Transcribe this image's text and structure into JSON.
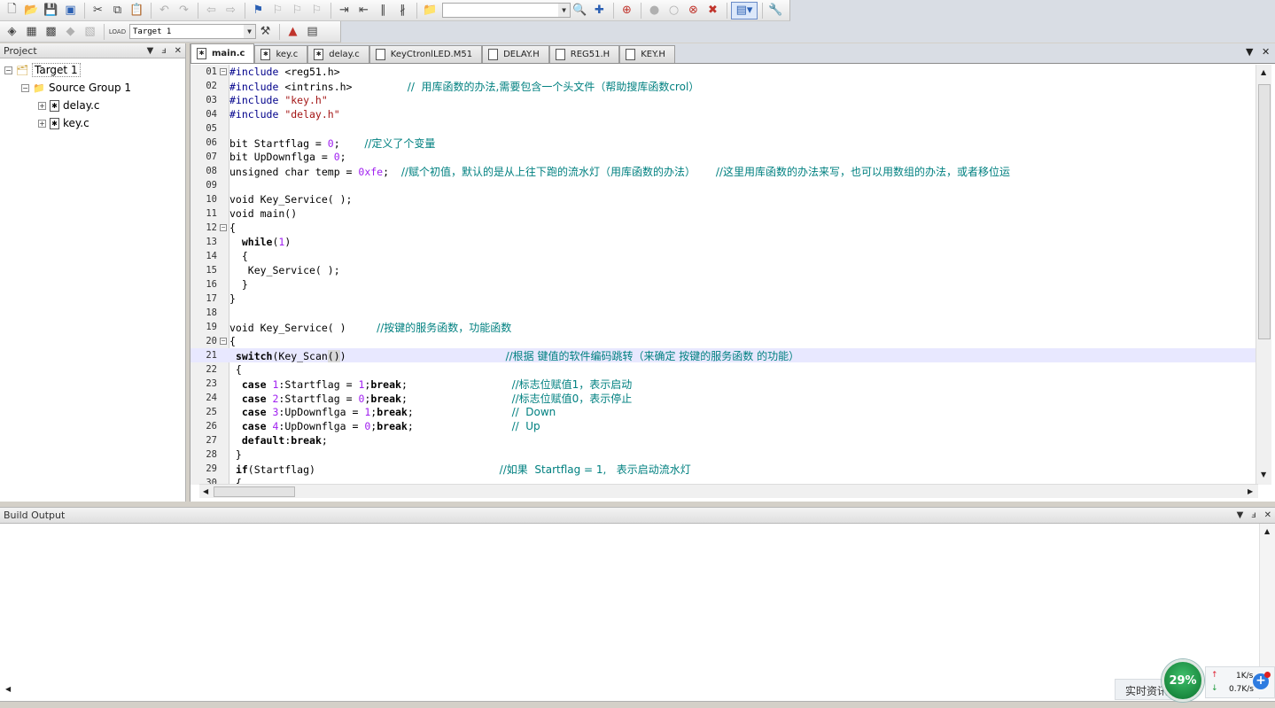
{
  "toolbar": {
    "device_combo": "",
    "target_combo": "Target 1"
  },
  "project_panel": {
    "title": "Project",
    "tree": {
      "target": "Target 1",
      "group": "Source Group 1",
      "files": [
        "delay.c",
        "key.c"
      ]
    }
  },
  "tabs": [
    {
      "label": "main.c",
      "active": true
    },
    {
      "label": "key.c",
      "active": false
    },
    {
      "label": "delay.c",
      "active": false
    },
    {
      "label": "KeyCtronlLED.M51",
      "active": false
    },
    {
      "label": "DELAY.H",
      "active": false
    },
    {
      "label": "REG51.H",
      "active": false
    },
    {
      "label": "KEY.H",
      "active": false
    }
  ],
  "code": {
    "current_line": 21,
    "lines": [
      {
        "n": "01",
        "fold": "minus",
        "tokens": [
          [
            "pp",
            "#include "
          ],
          [
            "plain",
            "<reg51.h>"
          ]
        ]
      },
      {
        "n": "02",
        "tokens": [
          [
            "pp",
            "#include "
          ],
          [
            "plain",
            "<intrins.h>         "
          ],
          [
            "cm",
            "//  用库函数的办法,需要包含一个头文件（帮助搜库函数crol）"
          ]
        ]
      },
      {
        "n": "03",
        "tokens": [
          [
            "pp",
            "#include "
          ],
          [
            "str",
            "\"key.h\""
          ]
        ]
      },
      {
        "n": "04",
        "tokens": [
          [
            "pp",
            "#include "
          ],
          [
            "str",
            "\"delay.h\""
          ]
        ]
      },
      {
        "n": "05",
        "tokens": []
      },
      {
        "n": "06",
        "tokens": [
          [
            "plain",
            "bit Startflag = "
          ],
          [
            "num",
            "0"
          ],
          [
            "plain",
            ";    "
          ],
          [
            "cm",
            "//定义了个变量"
          ]
        ]
      },
      {
        "n": "07",
        "tokens": [
          [
            "plain",
            "bit UpDownflga = "
          ],
          [
            "num",
            "0"
          ],
          [
            "plain",
            ";"
          ]
        ]
      },
      {
        "n": "08",
        "tokens": [
          [
            "plain",
            "unsigned char temp = "
          ],
          [
            "num",
            "0xfe"
          ],
          [
            "plain",
            ";  "
          ],
          [
            "cm",
            "//赋个初值，默认的是从上往下跑的流水灯（用库函数的办法）      //这里用库函数的办法来写，也可以用数组的办法，或者移位运"
          ]
        ]
      },
      {
        "n": "09",
        "tokens": []
      },
      {
        "n": "10",
        "tokens": [
          [
            "plain",
            "void Key_Service( );"
          ]
        ]
      },
      {
        "n": "11",
        "tokens": [
          [
            "plain",
            "void main()"
          ]
        ]
      },
      {
        "n": "12",
        "fold": "minus",
        "tokens": [
          [
            "plain",
            "{"
          ]
        ]
      },
      {
        "n": "13",
        "tokens": [
          [
            "plain",
            "  "
          ],
          [
            "kw",
            "while"
          ],
          [
            "plain",
            "("
          ],
          [
            "num",
            "1"
          ],
          [
            "plain",
            ")"
          ]
        ]
      },
      {
        "n": "14",
        "tokens": [
          [
            "plain",
            "  {"
          ]
        ]
      },
      {
        "n": "15",
        "tokens": [
          [
            "plain",
            "   Key_Service( );"
          ]
        ]
      },
      {
        "n": "16",
        "tokens": [
          [
            "plain",
            "  }"
          ]
        ]
      },
      {
        "n": "17",
        "tokens": [
          [
            "plain",
            "}"
          ]
        ]
      },
      {
        "n": "18",
        "tokens": []
      },
      {
        "n": "19",
        "tokens": [
          [
            "plain",
            "void Key_Service( )     "
          ],
          [
            "cm",
            "//按键的服务函数，功能函数"
          ]
        ]
      },
      {
        "n": "20",
        "fold": "minus",
        "tokens": [
          [
            "plain",
            "{"
          ]
        ]
      },
      {
        "n": "21",
        "tokens": [
          [
            "plain",
            " "
          ],
          [
            "kw",
            "switch"
          ],
          [
            "plain",
            "(Key_Scan"
          ],
          [
            "br",
            "()"
          ],
          [
            "plain",
            ")                          "
          ],
          [
            "cm",
            "//根据 键值的软件编码跳转（来确定 按键的服务函数 的功能）"
          ]
        ]
      },
      {
        "n": "22",
        "tokens": [
          [
            "plain",
            " {"
          ]
        ]
      },
      {
        "n": "23",
        "tokens": [
          [
            "plain",
            "  "
          ],
          [
            "kw",
            "case "
          ],
          [
            "num",
            "1"
          ],
          [
            "plain",
            ":Startflag = "
          ],
          [
            "num",
            "1"
          ],
          [
            "plain",
            ";"
          ],
          [
            "kw",
            "break"
          ],
          [
            "plain",
            ";                 "
          ],
          [
            "cm",
            "//标志位赋值1，表示启动"
          ]
        ]
      },
      {
        "n": "24",
        "tokens": [
          [
            "plain",
            "  "
          ],
          [
            "kw",
            "case "
          ],
          [
            "num",
            "2"
          ],
          [
            "plain",
            ":Startflag = "
          ],
          [
            "num",
            "0"
          ],
          [
            "plain",
            ";"
          ],
          [
            "kw",
            "break"
          ],
          [
            "plain",
            ";                 "
          ],
          [
            "cm",
            "//标志位赋值0，表示停止"
          ]
        ]
      },
      {
        "n": "25",
        "tokens": [
          [
            "plain",
            "  "
          ],
          [
            "kw",
            "case "
          ],
          [
            "num",
            "3"
          ],
          [
            "plain",
            ":UpDownflga = "
          ],
          [
            "num",
            "1"
          ],
          [
            "plain",
            ";"
          ],
          [
            "kw",
            "break"
          ],
          [
            "plain",
            ";                "
          ],
          [
            "cm",
            "//  Down"
          ]
        ]
      },
      {
        "n": "26",
        "tokens": [
          [
            "plain",
            "  "
          ],
          [
            "kw",
            "case "
          ],
          [
            "num",
            "4"
          ],
          [
            "plain",
            ":UpDownflga = "
          ],
          [
            "num",
            "0"
          ],
          [
            "plain",
            ";"
          ],
          [
            "kw",
            "break"
          ],
          [
            "plain",
            ";                "
          ],
          [
            "cm",
            "//  Up"
          ]
        ]
      },
      {
        "n": "27",
        "tokens": [
          [
            "plain",
            "  "
          ],
          [
            "kw",
            "default"
          ],
          [
            "plain",
            ":"
          ],
          [
            "kw",
            "break"
          ],
          [
            "plain",
            ";"
          ]
        ]
      },
      {
        "n": "28",
        "tokens": [
          [
            "plain",
            " }"
          ]
        ]
      },
      {
        "n": "29",
        "tokens": [
          [
            "plain",
            " "
          ],
          [
            "kw",
            "if"
          ],
          [
            "plain",
            "(Startflag)                              "
          ],
          [
            "cm",
            "//如果  Startflag = 1,   表示启动流水灯"
          ]
        ]
      },
      {
        "n": "30",
        "tokens": [
          [
            "plain",
            " {"
          ]
        ]
      }
    ]
  },
  "build_panel": {
    "title": "Build Output"
  },
  "net_widget": {
    "label": "实时资讯",
    "percent": "29%",
    "up_speed": "1K/s",
    "down_speed": "0.7K/s"
  },
  "colors": {
    "comment": "#008080",
    "preprocessor": "#00008b",
    "string": "#a31515",
    "number": "#a020f0",
    "current_line": "#e8e8ff"
  }
}
